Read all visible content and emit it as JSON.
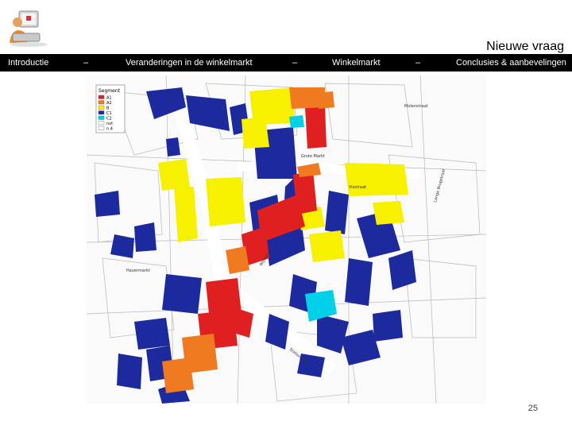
{
  "header": {
    "title": "Nieuwe vraag"
  },
  "nav": {
    "items": [
      {
        "label": "Introductie"
      },
      {
        "label": "–"
      },
      {
        "label": "Veranderingen in de winkelmarkt"
      },
      {
        "label": "–"
      },
      {
        "label": "Winkelmarkt"
      },
      {
        "label": "–"
      },
      {
        "label": "Conclusies & aanbevelingen"
      }
    ]
  },
  "map": {
    "legend_title": "Segment",
    "legend": [
      {
        "code": "A1",
        "color": "#e02020"
      },
      {
        "code": "A2",
        "color": "#f07a20"
      },
      {
        "code": "B",
        "color": "#f7f100"
      },
      {
        "code": "C1",
        "color": "#1d2a9e"
      },
      {
        "code": "C2",
        "color": "#00d0e8"
      },
      {
        "code": "nvt",
        "color": "#ffffff"
      },
      {
        "code": "n.4",
        "color": "#ffffff"
      }
    ],
    "street_labels": [
      "Grote Markt",
      "Wijnstraat",
      "Havermarkt",
      "Stationsweg",
      "Molenstraat",
      "Visstraat",
      "Lange Brugstraat"
    ]
  },
  "footer": {
    "page_number": "25"
  }
}
